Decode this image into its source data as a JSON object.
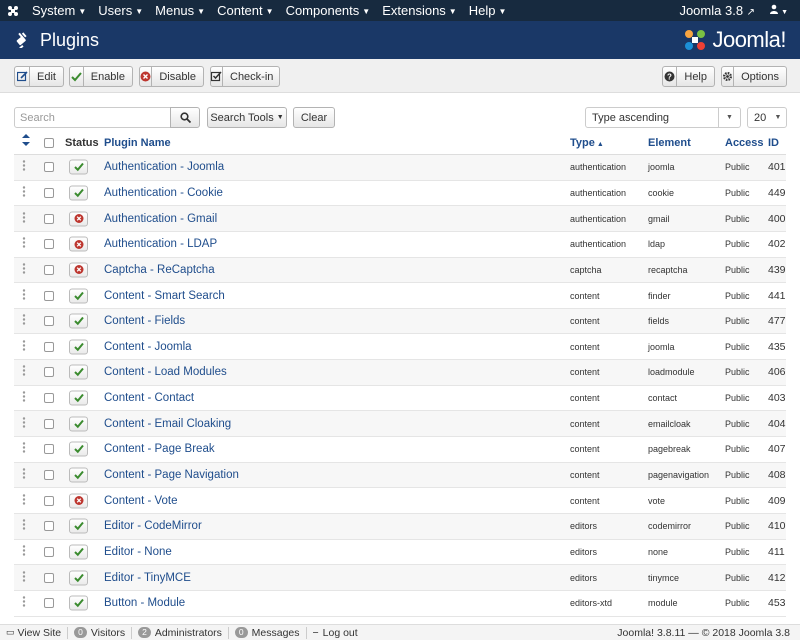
{
  "topnav": {
    "menu": [
      "System",
      "Users",
      "Menus",
      "Content",
      "Components",
      "Extensions",
      "Help"
    ],
    "site_label": "Joomla 3.8"
  },
  "header": {
    "title": "Plugins",
    "brand": "Joomla!"
  },
  "toolbar": {
    "edit": "Edit",
    "enable": "Enable",
    "disable": "Disable",
    "checkin": "Check-in",
    "help": "Help",
    "options": "Options"
  },
  "filters": {
    "search_placeholder": "Search",
    "search_tools": "Search Tools",
    "clear": "Clear",
    "ordering": "Type ascending",
    "limit": "20"
  },
  "table": {
    "columns": {
      "status": "Status",
      "name": "Plugin Name",
      "type": "Type",
      "element": "Element",
      "access": "Access",
      "id": "ID"
    },
    "rows": [
      {
        "name": "Authentication - Joomla",
        "enabled": true,
        "type": "authentication",
        "element": "joomla",
        "access": "Public",
        "id": "401"
      },
      {
        "name": "Authentication - Cookie",
        "enabled": true,
        "type": "authentication",
        "element": "cookie",
        "access": "Public",
        "id": "449"
      },
      {
        "name": "Authentication - Gmail",
        "enabled": false,
        "type": "authentication",
        "element": "gmail",
        "access": "Public",
        "id": "400"
      },
      {
        "name": "Authentication - LDAP",
        "enabled": false,
        "type": "authentication",
        "element": "ldap",
        "access": "Public",
        "id": "402"
      },
      {
        "name": "Captcha - ReCaptcha",
        "enabled": false,
        "type": "captcha",
        "element": "recaptcha",
        "access": "Public",
        "id": "439"
      },
      {
        "name": "Content - Smart Search",
        "enabled": true,
        "type": "content",
        "element": "finder",
        "access": "Public",
        "id": "441"
      },
      {
        "name": "Content - Fields",
        "enabled": true,
        "type": "content",
        "element": "fields",
        "access": "Public",
        "id": "477"
      },
      {
        "name": "Content - Joomla",
        "enabled": true,
        "type": "content",
        "element": "joomla",
        "access": "Public",
        "id": "435"
      },
      {
        "name": "Content - Load Modules",
        "enabled": true,
        "type": "content",
        "element": "loadmodule",
        "access": "Public",
        "id": "406"
      },
      {
        "name": "Content - Contact",
        "enabled": true,
        "type": "content",
        "element": "contact",
        "access": "Public",
        "id": "403"
      },
      {
        "name": "Content - Email Cloaking",
        "enabled": true,
        "type": "content",
        "element": "emailcloak",
        "access": "Public",
        "id": "404"
      },
      {
        "name": "Content - Page Break",
        "enabled": true,
        "type": "content",
        "element": "pagebreak",
        "access": "Public",
        "id": "407"
      },
      {
        "name": "Content - Page Navigation",
        "enabled": true,
        "type": "content",
        "element": "pagenavigation",
        "access": "Public",
        "id": "408"
      },
      {
        "name": "Content - Vote",
        "enabled": false,
        "type": "content",
        "element": "vote",
        "access": "Public",
        "id": "409"
      },
      {
        "name": "Editor - CodeMirror",
        "enabled": true,
        "type": "editors",
        "element": "codemirror",
        "access": "Public",
        "id": "410"
      },
      {
        "name": "Editor - None",
        "enabled": true,
        "type": "editors",
        "element": "none",
        "access": "Public",
        "id": "411"
      },
      {
        "name": "Editor - TinyMCE",
        "enabled": true,
        "type": "editors",
        "element": "tinymce",
        "access": "Public",
        "id": "412"
      },
      {
        "name": "Button - Module",
        "enabled": true,
        "type": "editors-xtd",
        "element": "module",
        "access": "Public",
        "id": "453"
      }
    ]
  },
  "footer": {
    "view_site": "View Site",
    "visitors_count": "0",
    "visitors": "Visitors",
    "admins_count": "2",
    "admins": "Administrators",
    "messages_count": "0",
    "messages": "Messages",
    "logout": "Log out",
    "copyright": "Joomla! 3.8.11 — © 2018 Joomla 3.8"
  },
  "colors": {
    "topnav_bg": "#172a3f",
    "header_bg": "#1a3867",
    "link": "#1f4d8c",
    "enabled": "#3b8b2f",
    "disabled": "#bd362f"
  }
}
